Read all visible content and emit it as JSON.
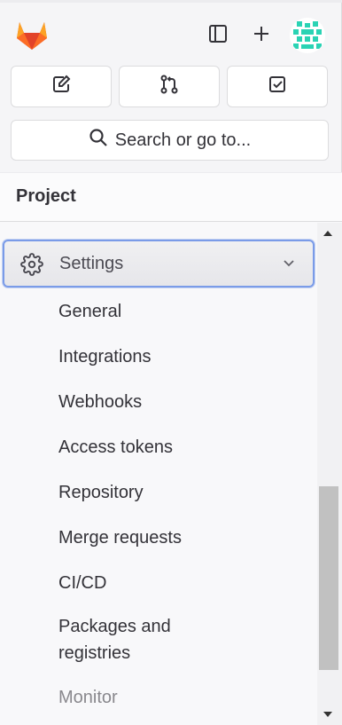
{
  "header": {
    "logo_icon": "gitlab-logo",
    "toggle_sidebar_icon": "sidebar-toggle-icon",
    "create_icon": "plus-icon",
    "avatar_icon": "user-avatar"
  },
  "quick_actions": [
    {
      "icon": "issues-icon"
    },
    {
      "icon": "merge-requests-icon"
    },
    {
      "icon": "todo-icon"
    }
  ],
  "search": {
    "label": "Search or go to..."
  },
  "section": {
    "title": "Project"
  },
  "nav": {
    "settings": {
      "label": "Settings",
      "expanded": true
    },
    "subitems": [
      {
        "label": "General"
      },
      {
        "label": "Integrations"
      },
      {
        "label": "Webhooks"
      },
      {
        "label": "Access tokens"
      },
      {
        "label": "Repository"
      },
      {
        "label": "Merge requests"
      },
      {
        "label": "CI/CD"
      },
      {
        "label": "Packages and registries"
      },
      {
        "label": "Monitor"
      }
    ]
  },
  "colors": {
    "logo_orange": "#e24329",
    "logo_light": "#fca326",
    "avatar_green": "#2ad3b4",
    "focus_border": "#7a9be8"
  }
}
